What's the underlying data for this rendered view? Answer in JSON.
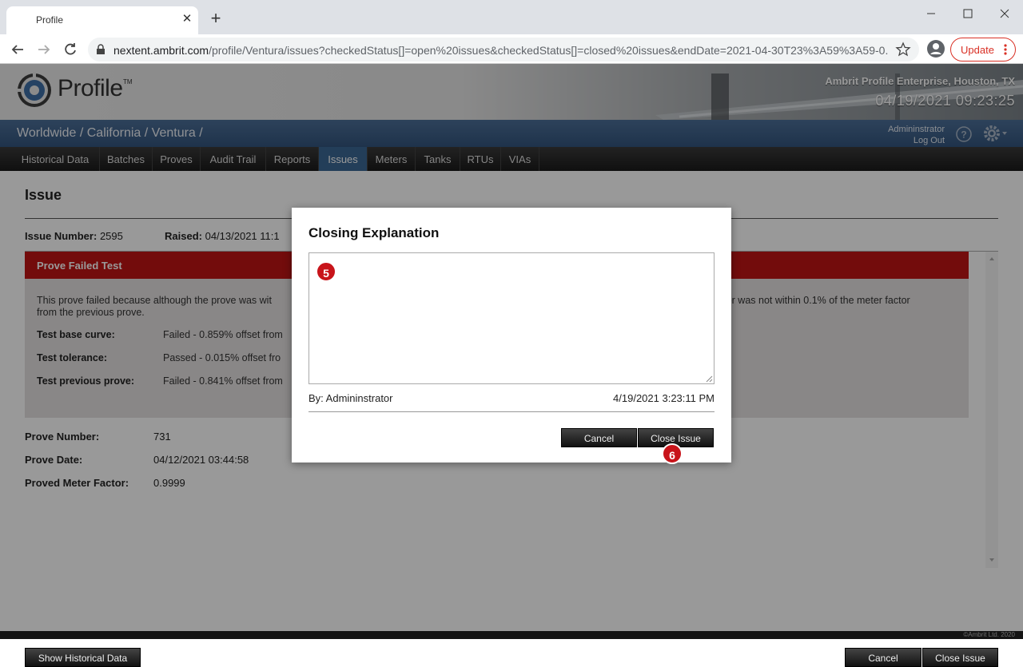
{
  "browser": {
    "tab_title": "Profile",
    "url_domain": "nextent.ambrit.com",
    "url_path": "/profile/Ventura/issues?checkedStatus[]=open%20issues&checkedStatus[]=closed%20issues&endDate=2021-04-30T23%3A59%3A59-0...",
    "update_label": "Update"
  },
  "header": {
    "logo_text": "Profile",
    "logo_tm": "TM",
    "company": "Ambrit Profile Enterprise, Houston, TX",
    "datetime": "04/19/2021 09:23:25"
  },
  "bluebar": {
    "breadcrumb": "Worldwide / California / Ventura /",
    "user_name": "Admininstrator",
    "logout": "Log Out"
  },
  "nav": {
    "items": [
      "Historical Data",
      "Batches",
      "Proves",
      "Audit Trail",
      "Reports",
      "Issues",
      "Meters",
      "Tanks",
      "RTUs",
      "VIAs"
    ],
    "active": "Issues"
  },
  "issue": {
    "title": "Issue",
    "number_label": "Issue Number:",
    "number_value": "2595",
    "raised_label": "Raised:",
    "raised_value": "04/13/2021 11:1",
    "alert_title": "Prove Failed Test",
    "alert_text_left": "This prove failed because although the prove was wit",
    "alert_text_right": "ctor was not within 0.1% of the meter factor",
    "alert_text_line2": "from the previous prove.",
    "tests": [
      {
        "label": "Test base curve:",
        "value": "Failed - 0.859% offset from"
      },
      {
        "label": "Test tolerance:",
        "value": "Passed - 0.015% offset fro"
      },
      {
        "label": "Test previous prove:",
        "value": "Failed - 0.841% offset from"
      }
    ],
    "info": [
      {
        "label": "Prove Number:",
        "value": "731"
      },
      {
        "label": "Prove Date:",
        "value": "04/12/2021 03:44:58"
      },
      {
        "label": "Proved Meter Factor:",
        "value": "0.9999"
      }
    ],
    "show_historical": "Show Historical Data",
    "cancel": "Cancel",
    "close_issue": "Close Issue"
  },
  "footer": {
    "copyright": "©Ambrit Ltd. 2020"
  },
  "dialog": {
    "title": "Closing Explanation",
    "textarea_value": "",
    "by": "By: Admininstrator",
    "date": "4/19/2021 3:23:11 PM",
    "cancel": "Cancel",
    "close_issue": "Close Issue",
    "badge_textarea": "5",
    "badge_close": "6"
  },
  "colors": {
    "accent_blue": "#3b6894",
    "alert_red": "#c01414",
    "badge_red": "#c8141a",
    "update_red": "#d93025"
  }
}
